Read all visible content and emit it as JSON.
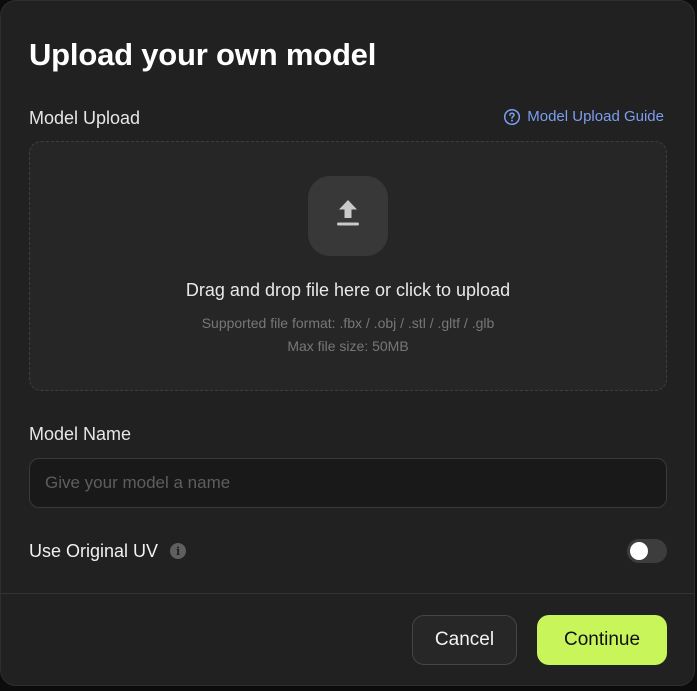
{
  "modal": {
    "title": "Upload your own model"
  },
  "upload": {
    "label": "Model Upload",
    "guide_link": "Model Upload Guide",
    "drop_text": "Drag and drop file here or click to upload",
    "supported_formats": "Supported file format: .fbx / .obj / .stl / .gltf / .glb",
    "max_size": "Max file size: 50MB",
    "icon": "upload-icon"
  },
  "model_name": {
    "label": "Model Name",
    "placeholder": "Give your model a name",
    "value": ""
  },
  "uv": {
    "label": "Use Original UV",
    "enabled": false
  },
  "footer": {
    "cancel_label": "Cancel",
    "continue_label": "Continue"
  },
  "colors": {
    "accent": "#c8f55a",
    "link": "#7c9ef0",
    "background": "#212121"
  }
}
